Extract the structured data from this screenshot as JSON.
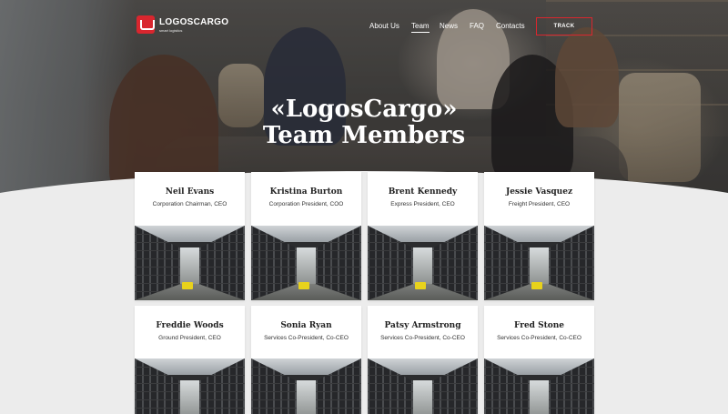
{
  "header": {
    "logo_name": "LOGOSCARGO",
    "logo_tagline": "smart logistics",
    "nav": [
      "About Us",
      "Team",
      "News",
      "FAQ",
      "Contacts"
    ],
    "active_nav": "Team",
    "track_label": "TRACK"
  },
  "hero": {
    "title_line1": "«LogosCargo»",
    "title_line2": "Team Members"
  },
  "team": [
    {
      "name": "Neil Evans",
      "role": "Corporation Chairman, CEO"
    },
    {
      "name": "Kristina Burton",
      "role": "Corporation President, COO"
    },
    {
      "name": "Brent Kennedy",
      "role": "Express President, CEO"
    },
    {
      "name": "Jessie Vasquez",
      "role": "Freight President, CEO"
    },
    {
      "name": "Freddie Woods",
      "role": "Ground President, CEO"
    },
    {
      "name": "Sonia Ryan",
      "role": "Services Co-President, Co-CEO"
    },
    {
      "name": "Patsy Armstrong",
      "role": "Services Co-President, Co-CEO"
    },
    {
      "name": "Fred Stone",
      "role": "Services Co-President, Co-CEO"
    }
  ],
  "colors": {
    "accent": "#d9262e",
    "background": "#ececec",
    "card": "#ffffff"
  }
}
